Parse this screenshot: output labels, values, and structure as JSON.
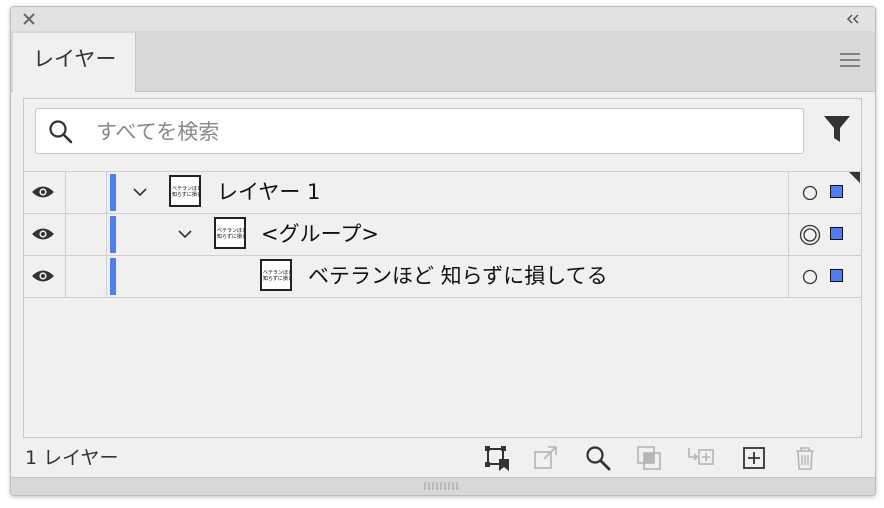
{
  "panel": {
    "tab_label": "レイヤー",
    "search": {
      "placeholder": "すべてを検索"
    },
    "layers": [
      {
        "name": "レイヤー 1",
        "level": 0,
        "expanded": true,
        "visible": true,
        "color": "#4f7df9",
        "thumb_text": "ベテランほど\n知らずに損してる",
        "targeted": false,
        "selected": true,
        "has_selection_marker": true
      },
      {
        "name": "<グループ>",
        "level": 1,
        "expanded": true,
        "visible": true,
        "color": "#4f7df9",
        "thumb_text": "ベテランほど\n知らずに損してる",
        "targeted": true,
        "selected": true,
        "has_selection_marker": false
      },
      {
        "name": "ベテランほど 知らずに損してる",
        "level": 2,
        "expanded": false,
        "visible": true,
        "color": "#4f7df9",
        "thumb_text": "ベテランほど\n知らずに損してる",
        "targeted": false,
        "selected": true,
        "has_selection_marker": false
      }
    ],
    "footer": {
      "layer_count": "1 レイヤー",
      "tools": [
        {
          "name": "collect-for-export-icon",
          "enabled": true
        },
        {
          "name": "export-icon",
          "enabled": false
        },
        {
          "name": "locate-object-icon",
          "enabled": true
        },
        {
          "name": "clipping-mask-icon",
          "enabled": false
        },
        {
          "name": "new-sublayer-icon",
          "enabled": false
        },
        {
          "name": "new-layer-icon",
          "enabled": true
        },
        {
          "name": "trash-icon",
          "enabled": false
        }
      ]
    }
  },
  "colors": {
    "layer_color": "#4f7df9",
    "panel_bg": "#f0f0f0",
    "icon_enabled": "#333333",
    "icon_disabled": "#b5b5b5"
  }
}
